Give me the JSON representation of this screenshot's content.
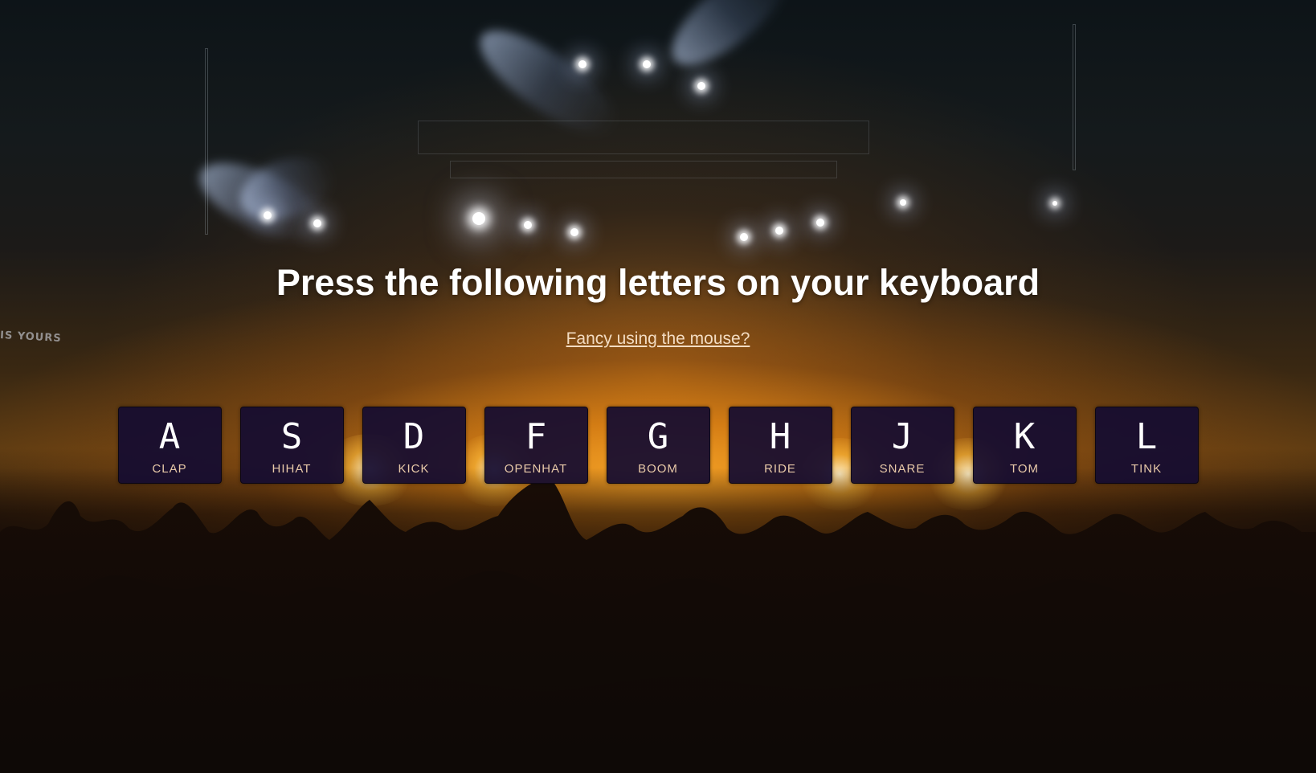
{
  "page": {
    "heading": "Press the following letters on your keyboard",
    "mouse_link": "Fancy using the mouse?",
    "background_text": "IS YOURS"
  },
  "keys": [
    {
      "letter": "A",
      "sound": "CLAP"
    },
    {
      "letter": "S",
      "sound": "HIHAT"
    },
    {
      "letter": "D",
      "sound": "KICK"
    },
    {
      "letter": "F",
      "sound": "OPENHAT"
    },
    {
      "letter": "G",
      "sound": "BOOM"
    },
    {
      "letter": "H",
      "sound": "RIDE"
    },
    {
      "letter": "J",
      "sound": "SNARE"
    },
    {
      "letter": "K",
      "sound": "TOM"
    },
    {
      "letter": "L",
      "sound": "TINK"
    }
  ],
  "colors": {
    "key_background": "#140c30",
    "key_letter": "#ffffff",
    "key_sound": "#e8c9a8",
    "heading": "#ffffff",
    "link": "#f3dcc2",
    "stage_glow": "#ffaa28"
  }
}
